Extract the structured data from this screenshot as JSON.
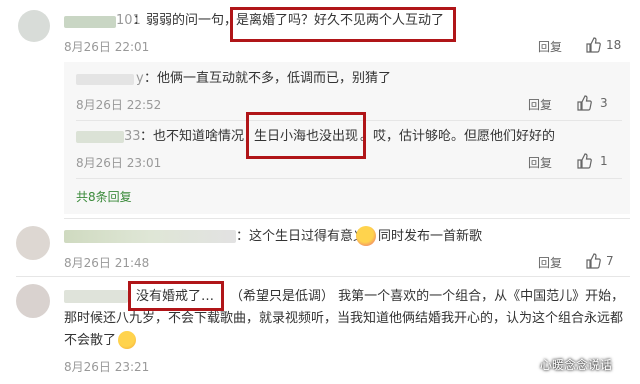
{
  "comments": [
    {
      "user_suffix": "101",
      "text_before": "：弱弱的问一句，",
      "text_highlight": "是离婚了吗？好久不见两个人互动了",
      "time": "8月26日 22:01",
      "reply_label": "回复",
      "likes": "18"
    },
    {
      "replies": [
        {
          "user_suffix": "y",
          "text": "：他俩一直互动就不多，低调而已，别猜了",
          "time": "8月26日 22:52",
          "reply_label": "回复",
          "likes": "3"
        },
        {
          "user_suffix": "33",
          "text_before": "：也不知道啥情况，",
          "text_highlight": "生日小海也没出现",
          "text_after": "。哎，估计够呛。但愿他们好好的",
          "time": "8月26日 23:01",
          "reply_label": "回复",
          "likes": "1"
        }
      ],
      "more_label": "共8条回复"
    },
    {
      "text_before": "：这个生日过得有意义",
      "text_after": "同时发布一首新歌",
      "time": "8月26日 21:48",
      "reply_label": "回复",
      "likes": "7"
    },
    {
      "text_highlight": "没有婚戒了…",
      "text_line1": "（希望只是低调） 我第一个喜欢的一个组合，从《中国范儿》开始，",
      "text_line2": "那时候还八九岁，不会下载歌曲，就录视频听，当我知道他俩结婚我开心的，认为这个组合永远都",
      "text_line3": "不会散了",
      "time": "8月26日 23:21"
    }
  ],
  "watermark": "心暖念念说话",
  "colors": {
    "highlight_border": "#b01518",
    "more_link": "#3a8a3a"
  }
}
